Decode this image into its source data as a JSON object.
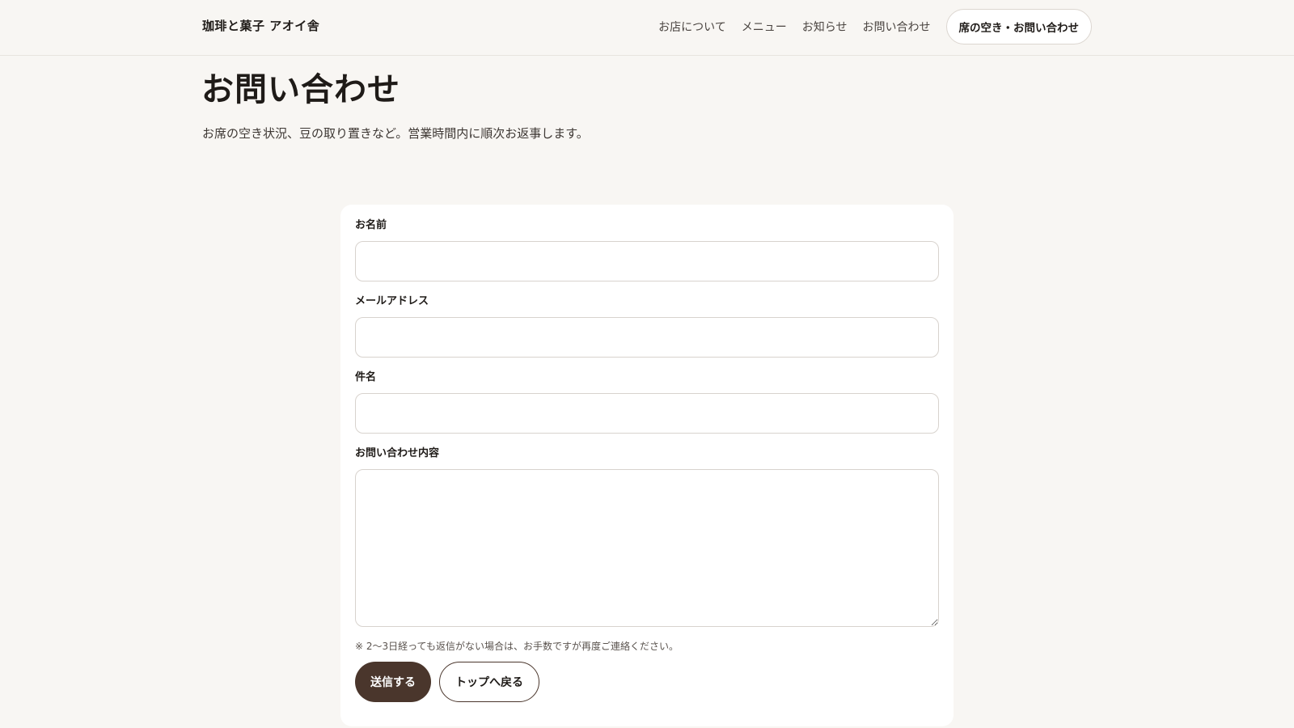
{
  "header": {
    "brand": "珈琲と菓子 アオイ舎",
    "nav": [
      "お店について",
      "メニュー",
      "お知らせ",
      "お問い合わせ"
    ],
    "cta": "席の空き・お問い合わせ"
  },
  "page": {
    "title": "お問い合わせ",
    "lead": "お席の空き状況、豆の取り置きなど。営業時間内に順次お返事します。"
  },
  "form": {
    "name_label": "お名前",
    "name_value": "",
    "email_label": "メールアドレス",
    "email_value": "",
    "subject_label": "件名",
    "subject_value": "",
    "message_label": "お問い合わせ内容",
    "message_value": "",
    "note": "※ 2〜3日経っても返信がない場合は、お手数ですが再度ご連絡ください。",
    "submit_label": "送信する",
    "back_label": "トップへ戻る"
  }
}
